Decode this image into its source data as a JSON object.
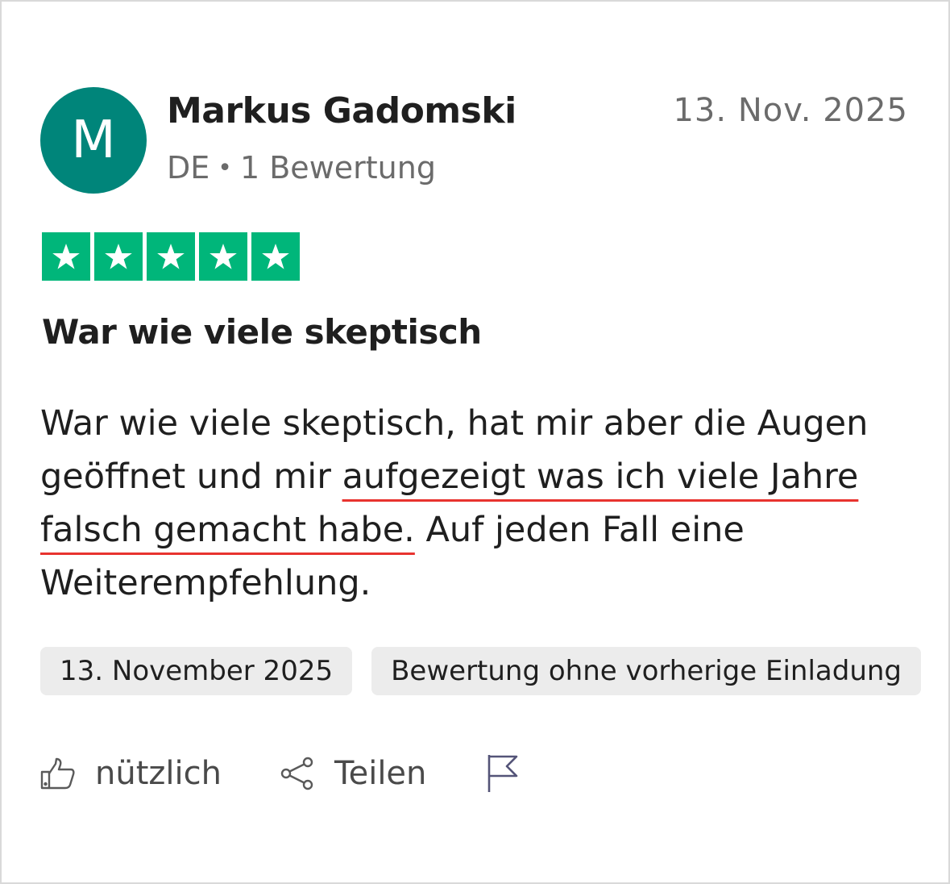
{
  "review": {
    "avatar_initial": "M",
    "avatar_color": "#00857a",
    "author_name": "Markus Gadomski",
    "country": "DE",
    "separator": "•",
    "review_count": "1 Bewertung",
    "date_short": "13. Nov. 2025",
    "rating": 5,
    "rating_max": 5,
    "star_color": "#00b67a",
    "title": "War wie viele skeptisch",
    "body_lines": [
      [
        {
          "text": "War wie viele skeptisch, hat mir aber die Augen",
          "hl": false
        }
      ],
      [
        {
          "text": "geöffnet und mir ",
          "hl": false
        },
        {
          "text": "aufgezeigt was ich viele Jahre",
          "hl": true
        }
      ],
      [
        {
          "text": "falsch gemacht habe.",
          "hl": true
        },
        {
          "text": " Auf jeden Fall eine",
          "hl": false
        }
      ],
      [
        {
          "text": "Weiterempfehlung.",
          "hl": false
        }
      ]
    ],
    "highlight_color": "#e8332f",
    "tags": [
      "13. November 2025",
      "Bewertung ohne vorherige Einladung"
    ]
  },
  "actions": {
    "useful_label": "nützlich",
    "useful_icon": "thumbs-up-icon",
    "share_label": "Teilen",
    "share_icon": "share-icon",
    "report_icon": "flag-icon"
  }
}
